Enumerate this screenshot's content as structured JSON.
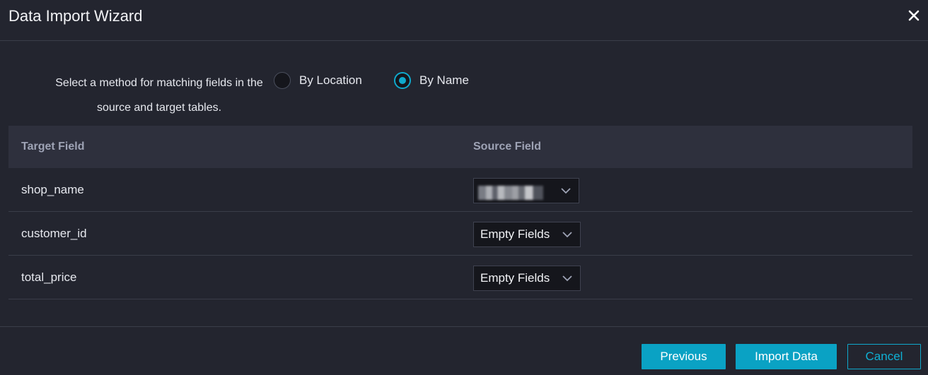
{
  "dialog": {
    "title": "Data Import Wizard",
    "close_icon": "close-icon"
  },
  "method": {
    "label_line1": "Select a method for matching fields in the",
    "label_line2": "source and target tables.",
    "options": [
      {
        "label": "By Location",
        "checked": false
      },
      {
        "label": "By Name",
        "checked": true
      }
    ]
  },
  "table": {
    "headers": [
      "Target Field",
      "Source Field"
    ],
    "rows": [
      {
        "target": "shop_name",
        "source": "",
        "source_blurred": true
      },
      {
        "target": "customer_id",
        "source": "Empty Fields",
        "source_blurred": false
      },
      {
        "target": "total_price",
        "source": "Empty Fields",
        "source_blurred": false
      }
    ],
    "dropdown_icon": "chevron-down-icon"
  },
  "footer": {
    "previous_label": "Previous",
    "import_label": "Import Data",
    "cancel_label": "Cancel"
  },
  "colors": {
    "background": "#23252f",
    "accent": "#0aa2c4",
    "header_row": "#2e303d"
  }
}
